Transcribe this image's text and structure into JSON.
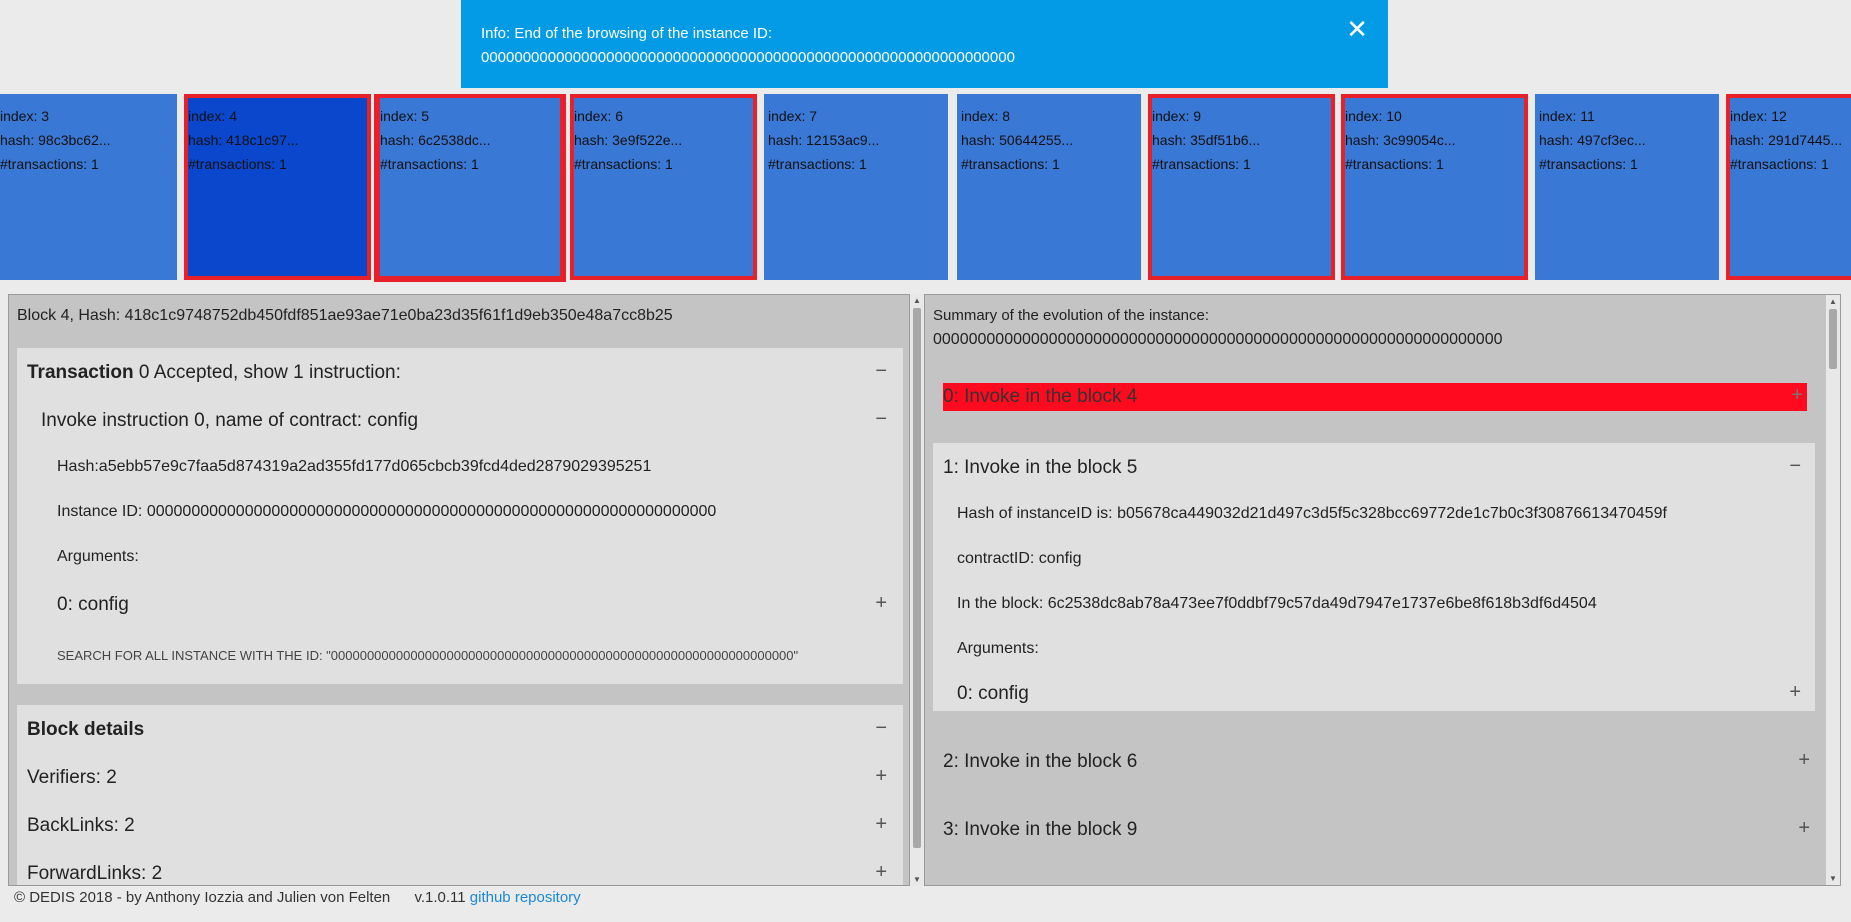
{
  "notification": {
    "title": "Info: End of the browsing of the instance ID:",
    "instance_id": "0000000000000000000000000000000000000000000000000000000000000000",
    "close_glyph": "✕"
  },
  "blocks": [
    {
      "index": "index: 3",
      "hash": "hash: 98c3bc62...",
      "tx": "#transactions: 1"
    },
    {
      "index": "index: 4",
      "hash": "hash: 418c1c97...",
      "tx": "#transactions: 1"
    },
    {
      "index": "index: 5",
      "hash": "hash: 6c2538dc...",
      "tx": "#transactions: 1"
    },
    {
      "index": "index: 6",
      "hash": "hash: 3e9f522e...",
      "tx": "#transactions: 1"
    },
    {
      "index": "index: 7",
      "hash": "hash: 12153ac9...",
      "tx": "#transactions: 1"
    },
    {
      "index": "index: 8",
      "hash": "hash: 50644255...",
      "tx": "#transactions: 1"
    },
    {
      "index": "index: 9",
      "hash": "hash: 35df51b6...",
      "tx": "#transactions: 1"
    },
    {
      "index": "index: 10",
      "hash": "hash: 3c99054c...",
      "tx": "#transactions: 1"
    },
    {
      "index": "index: 11",
      "hash": "hash: 497cf3ec...",
      "tx": "#transactions: 1"
    },
    {
      "index": "index: 12",
      "hash": "hash: 291d7445...",
      "tx": "#transactions: 1"
    }
  ],
  "left": {
    "block_title": "Block 4, Hash: 418c1c9748752db450fdf851ae93ae71e0ba23d35f61f1d9eb350e48a7cc8b25",
    "transaction_bold": "Transaction",
    "transaction_rest": " 0 Accepted, show 1 instruction:",
    "instruction": "Invoke instruction 0, name of contract: config",
    "hash": "Hash:a5ebb57e9c7faa5d874319a2ad355fd177d065cbcb39fcd4ded2879029395251",
    "instance": "Instance ID: 0000000000000000000000000000000000000000000000000000000000000000",
    "arguments": "Arguments:",
    "arg0": "0: config",
    "search": "SEARCH FOR ALL INSTANCE WITH THE ID: \"0000000000000000000000000000000000000000000000000000000000000000\"",
    "block_details": "Block details",
    "verifiers": "Verifiers: 2",
    "backlinks": "BackLinks: 2",
    "forwardlinks": "ForwardLinks: 2"
  },
  "right": {
    "summary_title": "Summary of the evolution of the instance:",
    "summary_id": "0000000000000000000000000000000000000000000000000000000000000000",
    "item0": "0: Invoke in the block 4",
    "item1": "1: Invoke in the block 5",
    "hash_instance": "Hash of instanceID is: b05678ca449032d21d497c3d5f5c328bcc69772de1c7b0c3f30876613470459f",
    "contract": "contractID: config",
    "in_block": "In the block: 6c2538dc8ab78a473ee7f0ddbf79c57da49d7947e1737e6be8f618b3df6d4504",
    "arguments": "Arguments:",
    "arg0": "0: config",
    "item2": "2: Invoke in the block 6",
    "item3": "3: Invoke in the block 9"
  },
  "footer": {
    "copy": "© DEDIS 2018 - by Anthony Iozzia and Julien von Felten",
    "version": "v.1.0.11",
    "link": "github repository"
  },
  "icons": {
    "minus": "−",
    "plus": "+"
  },
  "colors": {
    "accent": "#039be5",
    "block": "#3a78d6",
    "selected": "#0a47cc",
    "highlight": "#ff0a1e"
  }
}
